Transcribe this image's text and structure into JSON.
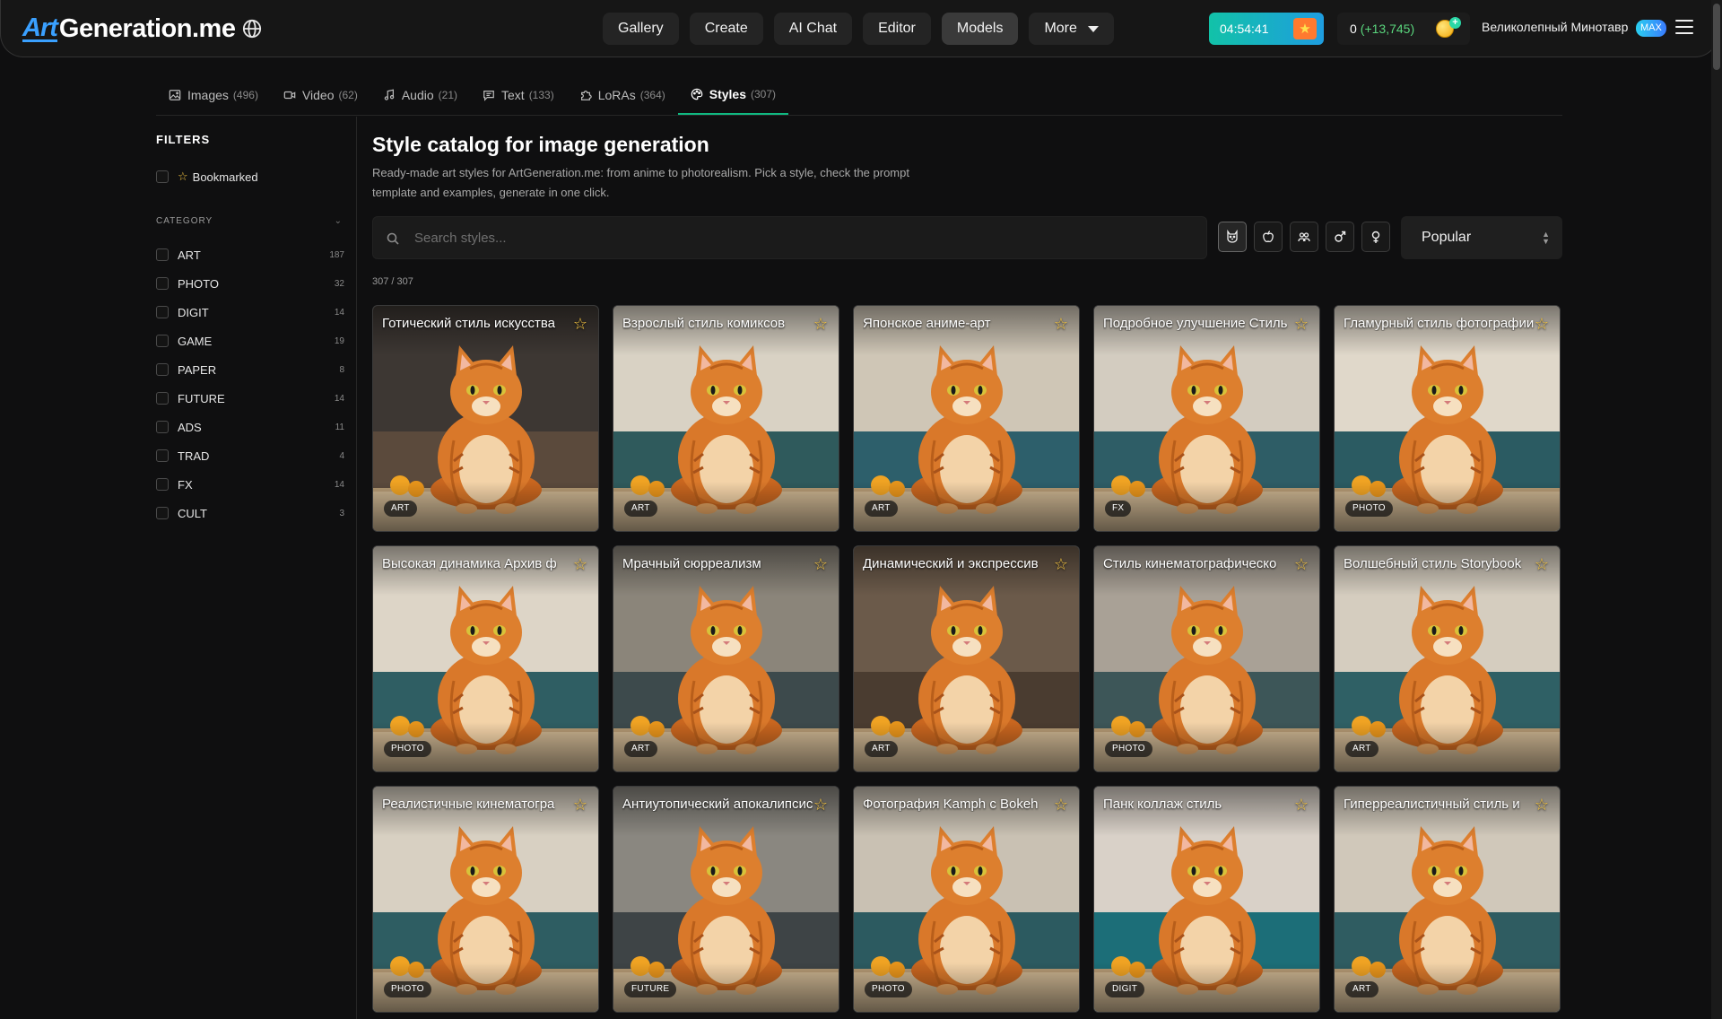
{
  "header": {
    "logo_art": "Art",
    "logo_rest": "Generation.me",
    "nav": [
      {
        "label": "Gallery",
        "active": false
      },
      {
        "label": "Create",
        "active": false
      },
      {
        "label": "AI Chat",
        "active": false
      },
      {
        "label": "Editor",
        "active": false
      },
      {
        "label": "Models",
        "active": true
      },
      {
        "label": "More",
        "active": false
      }
    ],
    "timer": "04:54:41",
    "credits": "0",
    "credits_bonus": "(+13,745)",
    "username": "Великолепный Минотавр",
    "plan_badge": "MAX"
  },
  "tabs": [
    {
      "label": "Images",
      "count": "(496)",
      "icon": "image-icon",
      "active": false
    },
    {
      "label": "Video",
      "count": "(62)",
      "icon": "video-icon",
      "active": false
    },
    {
      "label": "Audio",
      "count": "(21)",
      "icon": "music-icon",
      "active": false
    },
    {
      "label": "Text",
      "count": "(133)",
      "icon": "chat-icon",
      "active": false
    },
    {
      "label": "LoRAs",
      "count": "(364)",
      "icon": "puzzle-icon",
      "active": false
    },
    {
      "label": "Styles",
      "count": "(307)",
      "icon": "palette-icon",
      "active": true
    }
  ],
  "sidebar": {
    "filters_title": "FILTERS",
    "bookmarked_label": "Bookmarked",
    "category_title": "CATEGORY",
    "categories": [
      {
        "label": "ART",
        "count": "187"
      },
      {
        "label": "PHOTO",
        "count": "32"
      },
      {
        "label": "DIGIT",
        "count": "14"
      },
      {
        "label": "GAME",
        "count": "19"
      },
      {
        "label": "PAPER",
        "count": "8"
      },
      {
        "label": "FUTURE",
        "count": "14"
      },
      {
        "label": "ADS",
        "count": "11"
      },
      {
        "label": "TRAD",
        "count": "4"
      },
      {
        "label": "FX",
        "count": "14"
      },
      {
        "label": "CULT",
        "count": "3"
      }
    ]
  },
  "main": {
    "title": "Style catalog for image generation",
    "description": "Ready-made art styles for ArtGeneration.me: from anime to photorealism. Pick a style, check the prompt template and examples, generate in one click.",
    "search_placeholder": "Search styles...",
    "sort_value": "Popular",
    "result_count": "307 / 307",
    "filter_icons": [
      "cat-face-icon",
      "apple-icon",
      "people-icon",
      "male-icon",
      "female-icon"
    ],
    "cards": [
      {
        "title": "Готический стиль искусства",
        "tag": "ART",
        "bg": "#5b4a3c",
        "wall": "#3d3733"
      },
      {
        "title": "Взрослый стиль комиксов",
        "tag": "ART",
        "bg": "#2f5a5c",
        "wall": "#d9d2c4"
      },
      {
        "title": "Японское аниме-арт",
        "tag": "ART",
        "bg": "#2d5f6b",
        "wall": "#cfc6b6"
      },
      {
        "title": "Подробное улучшение Стиль",
        "tag": "FX",
        "bg": "#2e5d66",
        "wall": "#d3ccc0"
      },
      {
        "title": "Гламурный стиль фотографии",
        "tag": "PHOTO",
        "bg": "#2b5b62",
        "wall": "#e0d8ca"
      },
      {
        "title": "Высокая динамика Архив ф",
        "tag": "PHOTO",
        "bg": "#2f5e63",
        "wall": "#ddd5c7"
      },
      {
        "title": "Мрачный сюрреализм",
        "tag": "ART",
        "bg": "#3d4a4c",
        "wall": "#8b857a"
      },
      {
        "title": "Динамический и экспрессив",
        "tag": "ART",
        "bg": "#4a3c30",
        "wall": "#6b5a4a"
      },
      {
        "title": "Стиль кинематографическо",
        "tag": "PHOTO",
        "bg": "#3d5658",
        "wall": "#a9a196"
      },
      {
        "title": "Волшебный стиль Storybook",
        "tag": "ART",
        "bg": "#2f6065",
        "wall": "#d5cdbf"
      },
      {
        "title": "Реалистичные кинематогра",
        "tag": "PHOTO",
        "bg": "#2e5d62",
        "wall": "#d8d0c2"
      },
      {
        "title": "Антиутопический апокалипсис",
        "tag": "FUTURE",
        "bg": "#3e4446",
        "wall": "#8a8780"
      },
      {
        "title": "Фотография Kamph с Bokeh",
        "tag": "PHOTO",
        "bg": "#2c5a60",
        "wall": "#c9c1b3"
      },
      {
        "title": "Панк коллаж стиль",
        "tag": "DIGIT",
        "bg": "#1c6e78",
        "wall": "#d9d1c8"
      },
      {
        "title": "Гиперреалистичный стиль и",
        "tag": "ART",
        "bg": "#2f5c61",
        "wall": "#d0c8ba"
      }
    ]
  }
}
